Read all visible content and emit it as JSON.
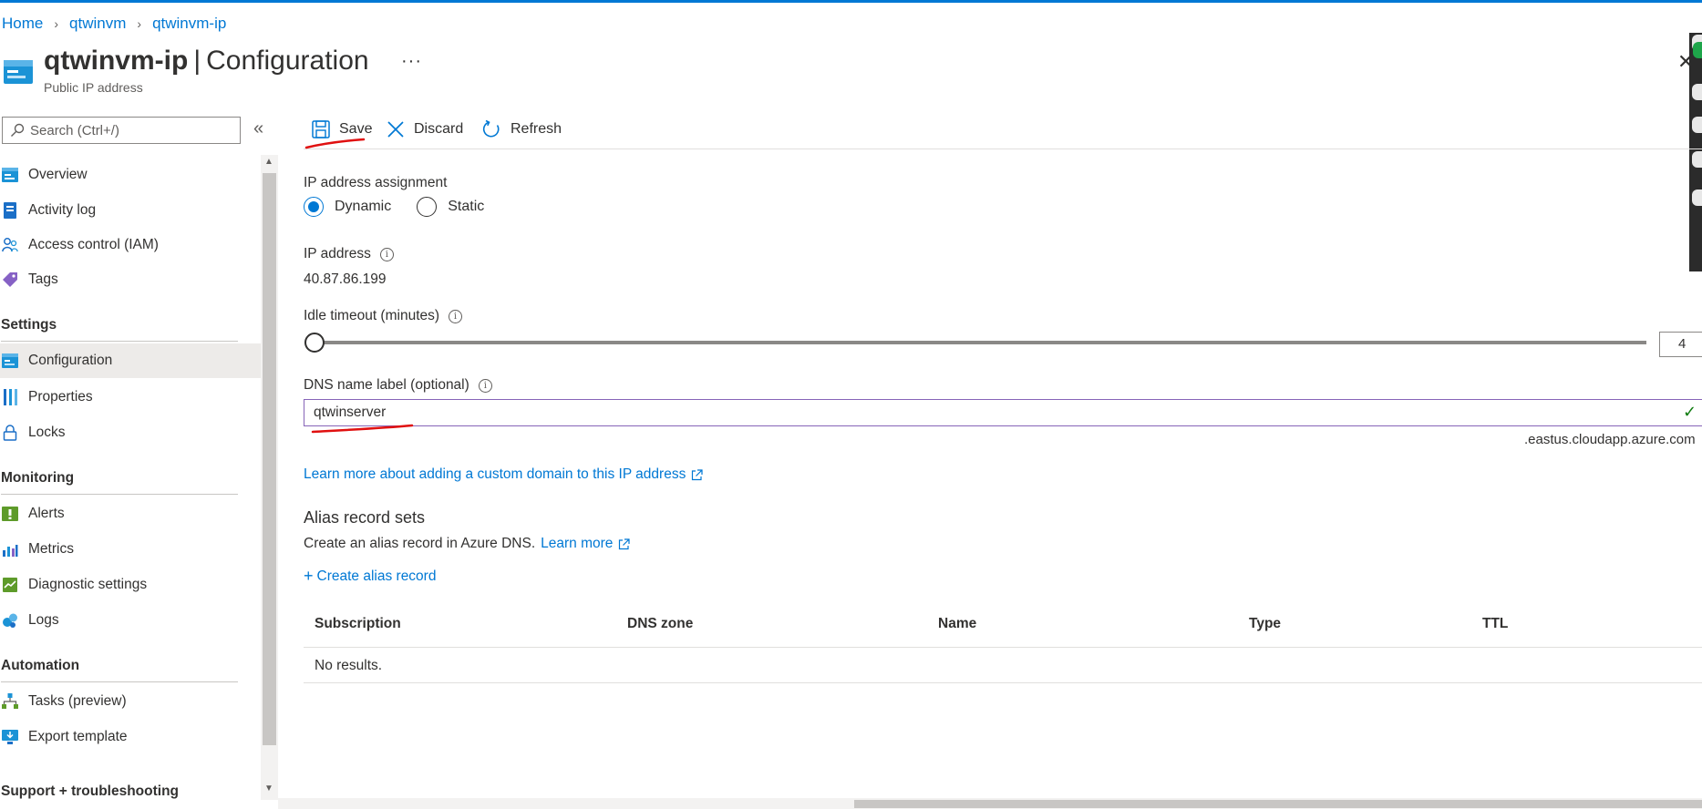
{
  "breadcrumb": {
    "items": [
      "Home",
      "qtwinvm",
      "qtwinvm-ip"
    ]
  },
  "header": {
    "resource_name": "qtwinvm-ip",
    "separator": "|",
    "blade_title": "Configuration",
    "more": "···",
    "subtitle": "Public IP address",
    "close": "✕"
  },
  "sidebar": {
    "search_placeholder": "Search (Ctrl+/)",
    "collapse": "«",
    "items": [
      {
        "label": "Overview"
      },
      {
        "label": "Activity log"
      },
      {
        "label": "Access control (IAM)"
      },
      {
        "label": "Tags"
      }
    ],
    "sections": [
      {
        "title": "Settings",
        "items": [
          {
            "label": "Configuration",
            "active": true
          },
          {
            "label": "Properties"
          },
          {
            "label": "Locks"
          }
        ]
      },
      {
        "title": "Monitoring",
        "items": [
          {
            "label": "Alerts"
          },
          {
            "label": "Metrics"
          },
          {
            "label": "Diagnostic settings"
          },
          {
            "label": "Logs"
          }
        ]
      },
      {
        "title": "Automation",
        "items": [
          {
            "label": "Tasks (preview)"
          },
          {
            "label": "Export template"
          }
        ]
      },
      {
        "title": "Support + troubleshooting"
      }
    ]
  },
  "toolbar": {
    "save": "Save",
    "discard": "Discard",
    "refresh": "Refresh"
  },
  "form": {
    "assignment_label": "IP address assignment",
    "assignment_options": [
      "Dynamic",
      "Static"
    ],
    "assignment_selected": "Dynamic",
    "ip_label": "IP address",
    "ip_value": "40.87.86.199",
    "idle_label": "Idle timeout (minutes)",
    "idle_value": "4",
    "dns_label": "DNS name label (optional)",
    "dns_value": "qtwinserver",
    "dns_suffix": ".eastus.cloudapp.azure.com",
    "learn_more_domain": "Learn more about adding a custom domain to this IP address"
  },
  "alias": {
    "title": "Alias record sets",
    "description": "Create an alias record in Azure DNS.",
    "learn_more": "Learn more",
    "create": "Create alias record",
    "columns": [
      "Subscription",
      "DNS zone",
      "Name",
      "Type",
      "TTL"
    ],
    "empty": "No results."
  },
  "colors": {
    "accent": "#0078d4",
    "annotation": "#e01010",
    "valid": "#107c10"
  }
}
